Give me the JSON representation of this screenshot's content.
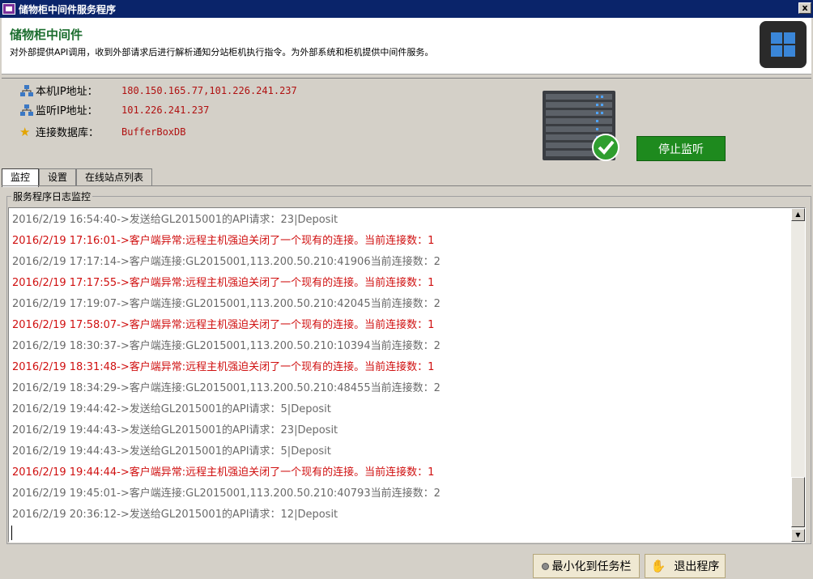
{
  "window": {
    "title": "储物柜中间件服务程序",
    "close_symbol": "x"
  },
  "header": {
    "title": "储物柜中间件",
    "description": "对外部提供API调用，收到外部请求后进行解析通知分站柜机执行指令。为外部系统和柜机提供中间件服务。"
  },
  "info": {
    "local_ip_label": "本机IP地址：",
    "local_ip_value": "180.150.165.77,101.226.241.237",
    "listen_ip_label": "监听IP地址：",
    "listen_ip_value": "101.226.241.237",
    "db_label": "连接数据库：",
    "db_value": "BufferBoxDB"
  },
  "actions": {
    "stop_listen": "停止监听",
    "minimize_to_tray": "最小化到任务栏",
    "exit_program": "退出程序"
  },
  "tabs": [
    "监控",
    "设置",
    "在线站点列表"
  ],
  "log_group_title": "服务程序日志监控",
  "log": [
    {
      "text": "2016/2/19 16:54:40->发送给GL2015001的API请求：23|Deposit",
      "level": "info"
    },
    {
      "text": "2016/2/19 17:16:01->客户端异常:远程主机强迫关闭了一个现有的连接。当前连接数：1",
      "level": "error"
    },
    {
      "text": "2016/2/19 17:17:14->客户端连接:GL2015001,113.200.50.210:41906当前连接数：2",
      "level": "info"
    },
    {
      "text": "2016/2/19 17:17:55->客户端异常:远程主机强迫关闭了一个现有的连接。当前连接数：1",
      "level": "error"
    },
    {
      "text": "2016/2/19 17:19:07->客户端连接:GL2015001,113.200.50.210:42045当前连接数：2",
      "level": "info"
    },
    {
      "text": "2016/2/19 17:58:07->客户端异常:远程主机强迫关闭了一个现有的连接。当前连接数：1",
      "level": "error"
    },
    {
      "text": "2016/2/19 18:30:37->客户端连接:GL2015001,113.200.50.210:10394当前连接数：2",
      "level": "info"
    },
    {
      "text": "2016/2/19 18:31:48->客户端异常:远程主机强迫关闭了一个现有的连接。当前连接数：1",
      "level": "error"
    },
    {
      "text": "2016/2/19 18:34:29->客户端连接:GL2015001,113.200.50.210:48455当前连接数：2",
      "level": "info"
    },
    {
      "text": "2016/2/19 19:44:42->发送给GL2015001的API请求：5|Deposit",
      "level": "info"
    },
    {
      "text": "2016/2/19 19:44:43->发送给GL2015001的API请求：23|Deposit",
      "level": "info"
    },
    {
      "text": "2016/2/19 19:44:43->发送给GL2015001的API请求：5|Deposit",
      "level": "info"
    },
    {
      "text": "2016/2/19 19:44:44->客户端异常:远程主机强迫关闭了一个现有的连接。当前连接数：1",
      "level": "error"
    },
    {
      "text": "2016/2/19 19:45:01->客户端连接:GL2015001,113.200.50.210:40793当前连接数：2",
      "level": "info"
    },
    {
      "text": "2016/2/19 20:36:12->发送给GL2015001的API请求：12|Deposit",
      "level": "info"
    }
  ],
  "colors": {
    "error_text": "#d01010",
    "info_text": "#6a6a6a",
    "stop_button": "#1e8a1e",
    "header_title": "#1b6d2e"
  },
  "icons": {
    "ip": "network-icon",
    "database": "star-icon",
    "server": "server-ok-icon"
  }
}
